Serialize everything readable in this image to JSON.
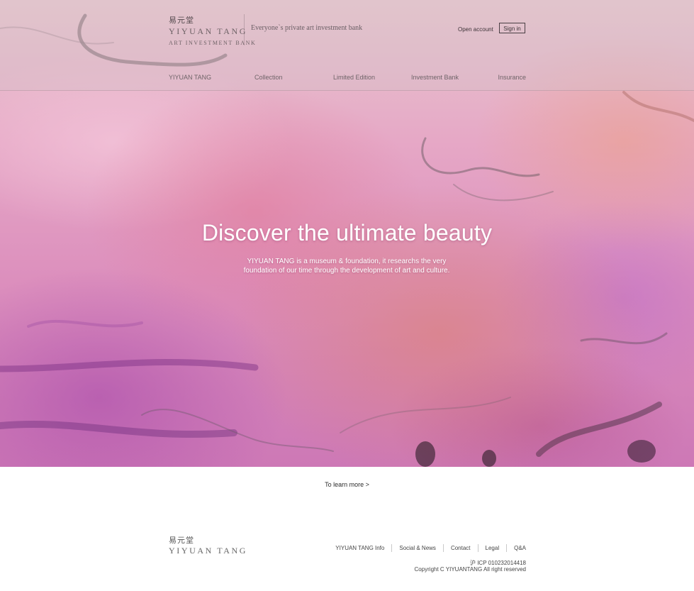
{
  "brand": {
    "name_cn": "易元堂",
    "name_en": "YIYUAN TANG",
    "subtitle": "ART INVESTMENT BANK",
    "tagline": "Everyone`s private art investment bank"
  },
  "header": {
    "open_account_label": "Open account",
    "sign_in_label": "Sign in"
  },
  "nav": {
    "items": [
      {
        "label": "YIYUAN TANG"
      },
      {
        "label": "Collection"
      },
      {
        "label": "Limited Edition"
      },
      {
        "label": "Investment Bank"
      },
      {
        "label": "Insurance"
      }
    ]
  },
  "hero": {
    "title": "Discover the ultimate beauty",
    "description": "YIYUAN TANG is a museum & foundation, it researchs the very foundation of our time through the development of art and culture."
  },
  "learn_more_label": "To learn more >",
  "footer": {
    "logo_cn": "易元堂",
    "logo_en": "YIYUAN TANG",
    "links": [
      {
        "label": "YIYUAN TANG Info"
      },
      {
        "label": "Social & News"
      },
      {
        "label": "Contact"
      },
      {
        "label": "Legal"
      },
      {
        "label": "Q&A"
      }
    ],
    "icp": "沪 ICP 010232014418",
    "copyright": "Copyright C YIYUANTANG All right reserved"
  },
  "colors": {
    "header_text": "#6f6468",
    "hero_pink": "#dc8fbd",
    "hero_purple": "#a546aa",
    "footer_text": "#444444"
  }
}
